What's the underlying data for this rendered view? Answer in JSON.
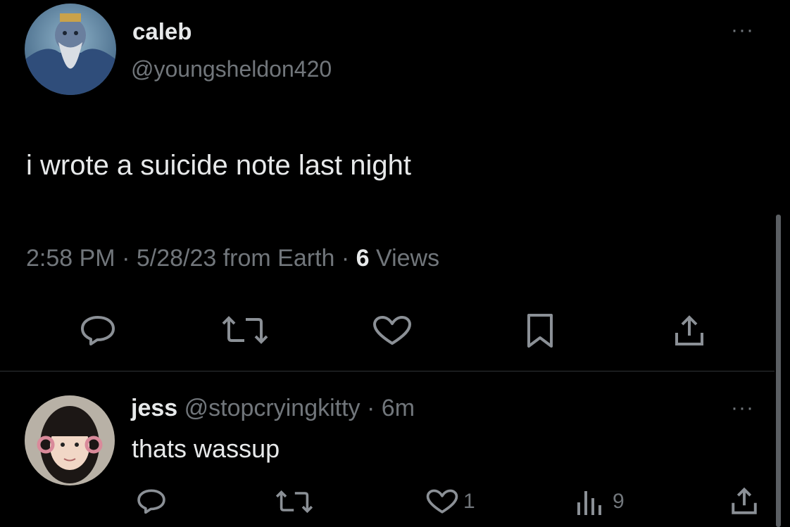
{
  "tweet": {
    "author_name": "caleb",
    "author_handle": "@youngsheldon420",
    "text": "i wrote a suicide note last night",
    "meta_time_date": "2:58 PM · 5/28/23 from Earth ·",
    "views_count": "6",
    "views_label": "Views",
    "more_label": "···",
    "actions": [
      "reply-icon",
      "retweet-icon",
      "like-icon",
      "bookmark-icon",
      "share-icon"
    ]
  },
  "reply": {
    "author_name": "jess",
    "author_handle": "@stopcryingkitty",
    "age": "· 6m",
    "text": "thats wassup",
    "like_count": "1",
    "views_count": "9",
    "more_label": "···"
  },
  "colors": {
    "background": "#000000",
    "text_primary": "#e7e9ea",
    "text_secondary": "#71767b",
    "divider": "#2f3336"
  }
}
